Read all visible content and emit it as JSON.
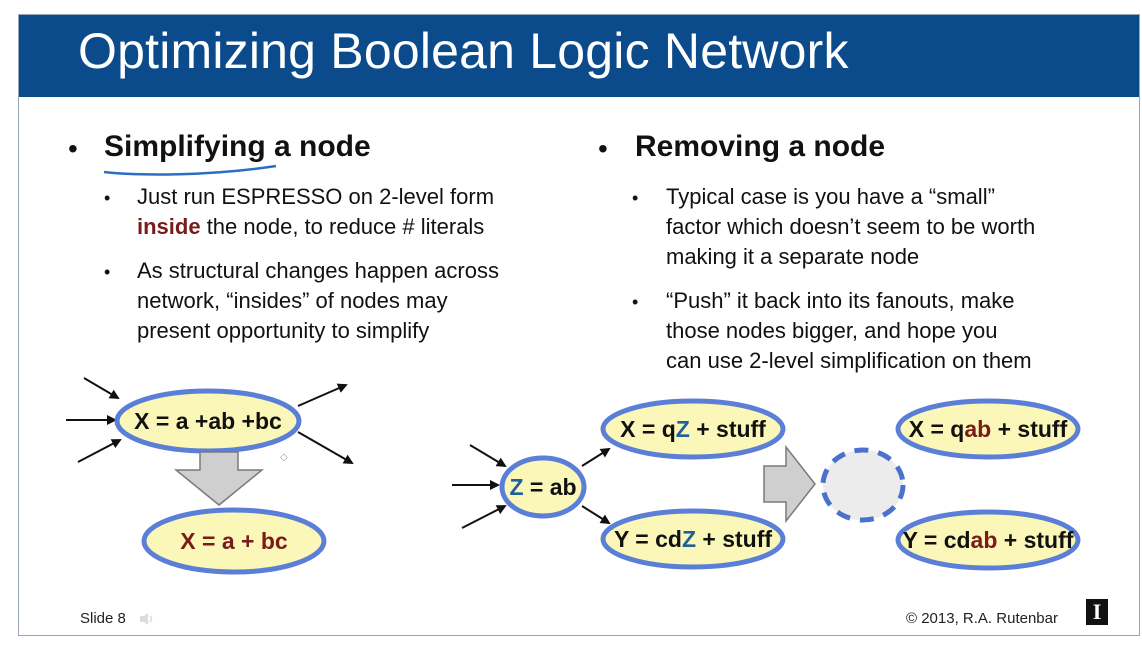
{
  "title": "Optimizing Boolean Logic Network",
  "left": {
    "heading": "Simplifying a node",
    "points": [
      {
        "line1": "Just run ESPRESSO on 2-level form",
        "emph": "inside",
        "rest": " the node, to reduce # literals"
      },
      {
        "line1": "As structural changes happen across",
        "line2": "network, “insides” of nodes may",
        "line3": "present opportunity to simplify"
      }
    ]
  },
  "right": {
    "heading": "Removing a node",
    "points": [
      {
        "line1": "Typical case is you have a “small”",
        "line2": "factor which doesn’t seem to be worth",
        "line3": "making it a separate node"
      },
      {
        "line1": "“Push” it back into its fanouts, make",
        "line2": "those nodes bigger, and hope you",
        "line3": "can use 2-level simplification on them"
      }
    ]
  },
  "diagram": {
    "left_top": "X = a +ab +bc",
    "left_bottom_prefix": "X = a + bc",
    "z_prefix": "Z",
    "z_rest": " = ab",
    "x1_prefix": "X = q",
    "x1_z": "Z",
    "x1_rest": " + stuff",
    "y1_prefix": "Y = cd",
    "y1_z": "Z",
    "y1_rest": " + stuff",
    "x2_prefix": "X = q",
    "x2_ab": "ab",
    "x2_rest": " + stuff",
    "y2_prefix": "Y = cd",
    "y2_ab": "ab",
    "y2_rest": " + stuff"
  },
  "footer": {
    "slide": "Slide 8",
    "copyright": "© 2013, R.A. Rutenbar",
    "logo": "I"
  },
  "colors": {
    "title_bar": "#0b4a8b",
    "node_fill": "#fbf7b8",
    "node_stroke": "#5b7fd6",
    "emphasis": "#7a1b1b",
    "z_blue": "#1f5f9a"
  }
}
